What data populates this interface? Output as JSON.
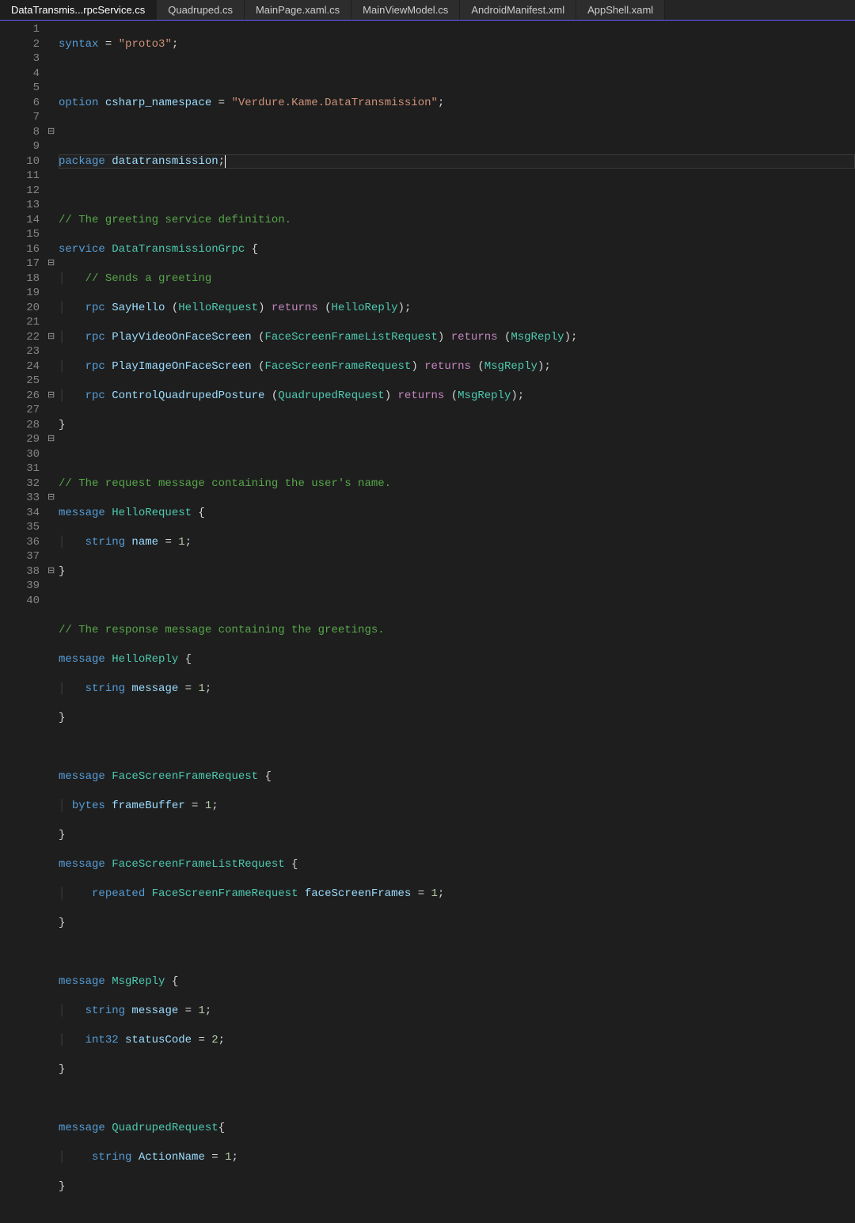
{
  "tabs": [
    {
      "label": "DataTransmis...rpcService.cs"
    },
    {
      "label": "Quadruped.cs"
    },
    {
      "label": "MainPage.xaml.cs"
    },
    {
      "label": "MainViewModel.cs"
    },
    {
      "label": "AndroidManifest.xml"
    },
    {
      "label": "AppShell.xaml"
    }
  ],
  "code": {
    "l1": {
      "syntax": "syntax",
      "eq": " = ",
      "str": "\"proto3\"",
      "semi": ";"
    },
    "l3": {
      "option": "option",
      "ns": " csharp_namespace",
      "eq": " = ",
      "str": "\"Verdure.Kame.DataTransmission\"",
      "semi": ";"
    },
    "l5": {
      "package": "package",
      "name": " datatransmission",
      "semi": ";"
    },
    "l7": {
      "comment": "// The greeting service definition."
    },
    "l8": {
      "service": "service",
      "name": " DataTransmissionGrpc",
      "ob": " {"
    },
    "l9": {
      "comment": "  // Sends a greeting"
    },
    "l10": {
      "rpc": "  rpc",
      "m": " SayHello ",
      "op": "(",
      "req": "HelloRequest",
      "cp": ")",
      "ret": " returns ",
      "op2": "(",
      "res": "HelloReply",
      "cp2": ")",
      "semi": ";"
    },
    "l11": {
      "rpc": "  rpc",
      "m": " PlayVideoOnFaceScreen ",
      "op": "(",
      "req": "FaceScreenFrameListRequest",
      "cp": ")",
      "ret": " returns ",
      "op2": "(",
      "res": "MsgReply",
      "cp2": ")",
      "semi": ";"
    },
    "l12": {
      "rpc": "  rpc",
      "m": " PlayImageOnFaceScreen ",
      "op": "(",
      "req": "FaceScreenFrameRequest",
      "cp": ")",
      "ret": " returns ",
      "op2": "(",
      "res": "MsgReply",
      "cp2": ")",
      "semi": ";"
    },
    "l13": {
      "rpc": "  rpc",
      "m": " ControlQuadrupedPosture ",
      "op": "(",
      "req": "QuadrupedRequest",
      "cp": ")",
      "ret": " returns ",
      "op2": "(",
      "res": "MsgReply",
      "cp2": ")",
      "semi": ";"
    },
    "l14": {
      "cb": "}"
    },
    "l16": {
      "comment": "// The request message containing the user's name."
    },
    "l17": {
      "message": "message",
      "name": " HelloRequest",
      "ob": " {"
    },
    "l18": {
      "ty": "  string",
      "fn": " name",
      "eq": " = ",
      "num": "1",
      "semi": ";"
    },
    "l19": {
      "cb": "}"
    },
    "l21": {
      "comment": "// The response message containing the greetings."
    },
    "l22": {
      "message": "message",
      "name": " HelloReply",
      "ob": " {"
    },
    "l23": {
      "ty": "  string",
      "fn": " message",
      "eq": " = ",
      "num": "1",
      "semi": ";"
    },
    "l24": {
      "cb": "}"
    },
    "l26": {
      "message": "message",
      "name": " FaceScreenFrameRequest",
      "ob": " {"
    },
    "l27": {
      "ty": "bytes",
      "fn": " frameBuffer",
      "eq": " = ",
      "num": "1",
      "semi": ";"
    },
    "l28": {
      "cb": "}"
    },
    "l29": {
      "message": "message",
      "name": " FaceScreenFrameListRequest",
      "ob": " {"
    },
    "l30": {
      "rep": "   repeated",
      "ty": " FaceScreenFrameRequest",
      "fn": " faceScreenFrames",
      "eq": " = ",
      "num": "1",
      "semi": ";"
    },
    "l31": {
      "cb": "}"
    },
    "l33": {
      "message": "message",
      "name": " MsgReply",
      "ob": " {"
    },
    "l34": {
      "ty": "  string",
      "fn": " message",
      "eq": " = ",
      "num": "1",
      "semi": ";"
    },
    "l35": {
      "ty": "  int32",
      "fn": " statusCode",
      "eq": " = ",
      "num": "2",
      "semi": ";"
    },
    "l36": {
      "cb": "}"
    },
    "l38": {
      "message": "message",
      "name": " QuadrupedRequest",
      "ob": "{"
    },
    "l39": {
      "ty": "   string",
      "fn": " ActionName",
      "eq": " = ",
      "num": "1",
      "semi": ";"
    },
    "l40": {
      "cb": "}"
    }
  },
  "line_numbers": [
    "1",
    "2",
    "3",
    "4",
    "5",
    "6",
    "7",
    "8",
    "9",
    "10",
    "11",
    "12",
    "13",
    "14",
    "15",
    "16",
    "17",
    "18",
    "19",
    "20",
    "21",
    "22",
    "23",
    "24",
    "25",
    "26",
    "27",
    "28",
    "29",
    "30",
    "31",
    "32",
    "33",
    "34",
    "35",
    "36",
    "37",
    "38",
    "39",
    "40"
  ],
  "folds": [
    "",
    "",
    "",
    "",
    "",
    "",
    "",
    "⊟",
    "",
    "",
    "",
    "",
    "",
    "",
    "",
    "",
    "⊟",
    "",
    "",
    "",
    "",
    "⊟",
    "",
    "",
    "",
    "⊟",
    "",
    "",
    "⊟",
    "",
    "",
    "",
    "⊟",
    "",
    "",
    "",
    "",
    "⊟",
    "",
    ""
  ]
}
